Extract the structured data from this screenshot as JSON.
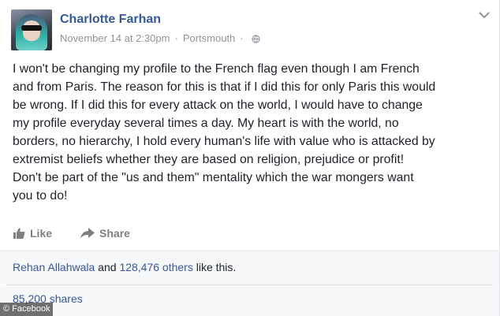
{
  "post": {
    "author_name": "Charlotte Farhan",
    "date": "November 14 at 2:30pm",
    "separator": "·",
    "location": "Portsmouth",
    "separator2": "·",
    "privacy_icon": "globe-icon",
    "menu_icon": "chevron-down-icon",
    "body_lines": [
      "I won't be changing my profile to the French flag even though I am French",
      "and from Paris. The reason for this is that if I did this for only Paris this would",
      "be wrong. If I did this for every attack on the world, I would have to change",
      "my profile everyday several times a day. My heart is with the world, no",
      "borders, no hierarchy, I hold every human's life with value who is attacked by",
      "extremist beliefs whether they are based on religion, prejudice or profit!",
      "Don't be part of the \"us and them\" mentality which the war mongers want",
      "you to do!"
    ]
  },
  "actions": {
    "like_label": "Like",
    "like_icon": "thumbs-up-icon",
    "share_label": "Share",
    "share_icon": "share-arrow-icon"
  },
  "reactions": {
    "first_name": "Rehan Allahwala",
    "and_text": " and ",
    "others_text": "128,476 others",
    "like_suffix": " like this."
  },
  "shares": {
    "text": "85,200 shares"
  },
  "watermark": {
    "text": "© Facebook"
  },
  "colors": {
    "link": "#365899",
    "meta": "#90949c",
    "text": "#1d2129"
  }
}
